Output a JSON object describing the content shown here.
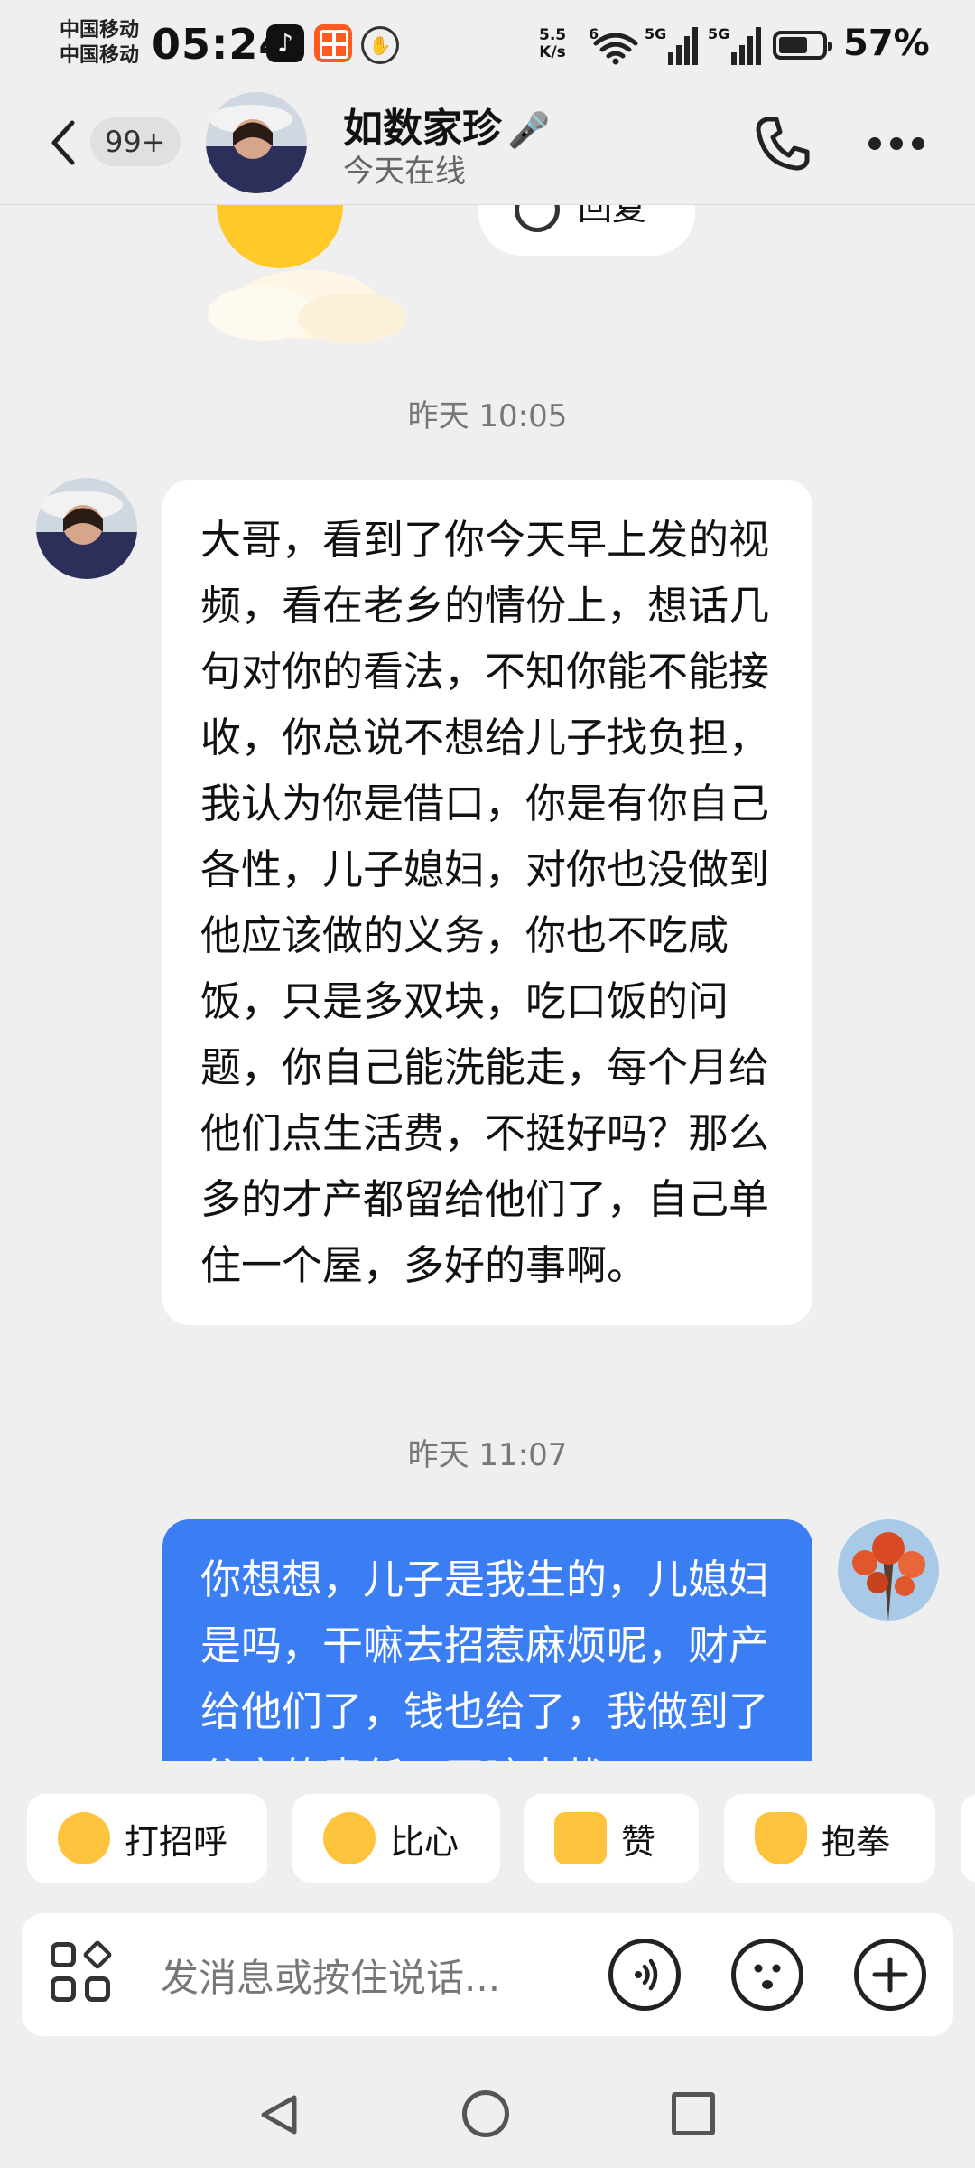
{
  "status_bar": {
    "carrier_1": "中国移动",
    "carrier_2": "中国移动",
    "time": "05:24",
    "net_speed_value": "5.5",
    "net_speed_unit": "K/s",
    "wifi_label": "6",
    "sim1_label": "5G",
    "sim2_label": "5G",
    "battery_percent": "57%"
  },
  "header": {
    "unread_count": "99+",
    "contact_name": "如数家珍",
    "status": "今天在线"
  },
  "chat": {
    "previous_reply_label": "回复",
    "messages": [
      {
        "timestamp": "昨天 10:05",
        "direction": "incoming",
        "text": "大哥，看到了你今天早上发的视频，看在老乡的情份上，想话几句对你的看法，不知你能不能接收，你总说不想给儿子找负担，我认为你是借口，你是有你自己各性，儿子媳妇，对你也没做到他应该做的义务，你也不吃咸饭，只是多双块，吃口饭的问题，你自己能洗能走，每个月给他们点生活费，不挺好吗？那么多的才产都留给他们了，自己单住一个屋，多好的事啊。"
      },
      {
        "timestamp": "昨天 11:07",
        "direction": "outgoing",
        "text": "你想想，儿子是我生的，儿媳妇是吗，干嘛去招惹麻烦呢，财产给他们了，钱也给了，我做到了父亲的责任，干嘛去找"
      }
    ]
  },
  "quick_replies": [
    {
      "label": "打招呼",
      "icon": "wave-emoji-icon"
    },
    {
      "label": "比心",
      "icon": "finger-heart-emoji-icon"
    },
    {
      "label": "赞",
      "icon": "thumbs-up-emoji-icon"
    },
    {
      "label": "抱拳",
      "icon": "fist-salute-emoji-icon"
    }
  ],
  "input": {
    "placeholder": "发消息或按住说话..."
  },
  "colors": {
    "background": "#efefef",
    "outgoing_bubble": "#3b7ef3",
    "incoming_bubble": "#ffffff",
    "timestamp_text": "#777777"
  }
}
